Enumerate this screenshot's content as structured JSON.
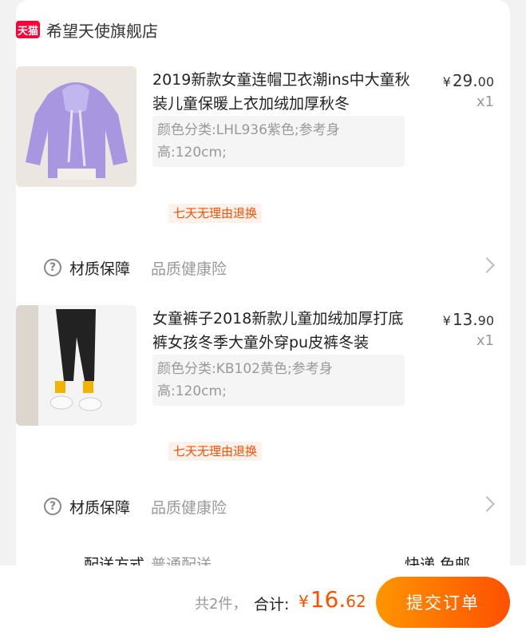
{
  "shop": {
    "badge": "天猫",
    "name": "希望天使旗舰店"
  },
  "products": [
    {
      "title": "2019新款女童连帽卫衣潮ins中大童秋装儿童保暖上衣加绒加厚秋冬",
      "price_yen": "¥",
      "price_int": "29.",
      "price_dec": "00",
      "qty": "x1",
      "sku": "颜色分类:LHL936紫色;参考身高:120cm;",
      "tag": "七天无理由退换",
      "service_label": "材质保障",
      "service_value": "品质健康险"
    },
    {
      "title": "女童裤子2018新款儿童加绒加厚打底裤女孩冬季大童外穿pu皮裤冬装",
      "price_yen": "¥",
      "price_int": "13.",
      "price_dec": "90",
      "qty": "x1",
      "sku": "颜色分类:KB102黄色;参考身高:120cm;",
      "tag": "七天无理由退换",
      "service_label": "材质保障",
      "service_value": "品质健康险"
    }
  ],
  "delivery": {
    "label": "配送方式",
    "value": "普通配送",
    "right": "快递 免邮"
  },
  "footer": {
    "count": "共2件，",
    "total_label": "合计:",
    "total_yen": "¥",
    "total_int": "16.",
    "total_dec": "62",
    "submit": "提交订单"
  },
  "colors": {
    "accent": "#ff5000",
    "tmall_red": "#ff0036"
  }
}
